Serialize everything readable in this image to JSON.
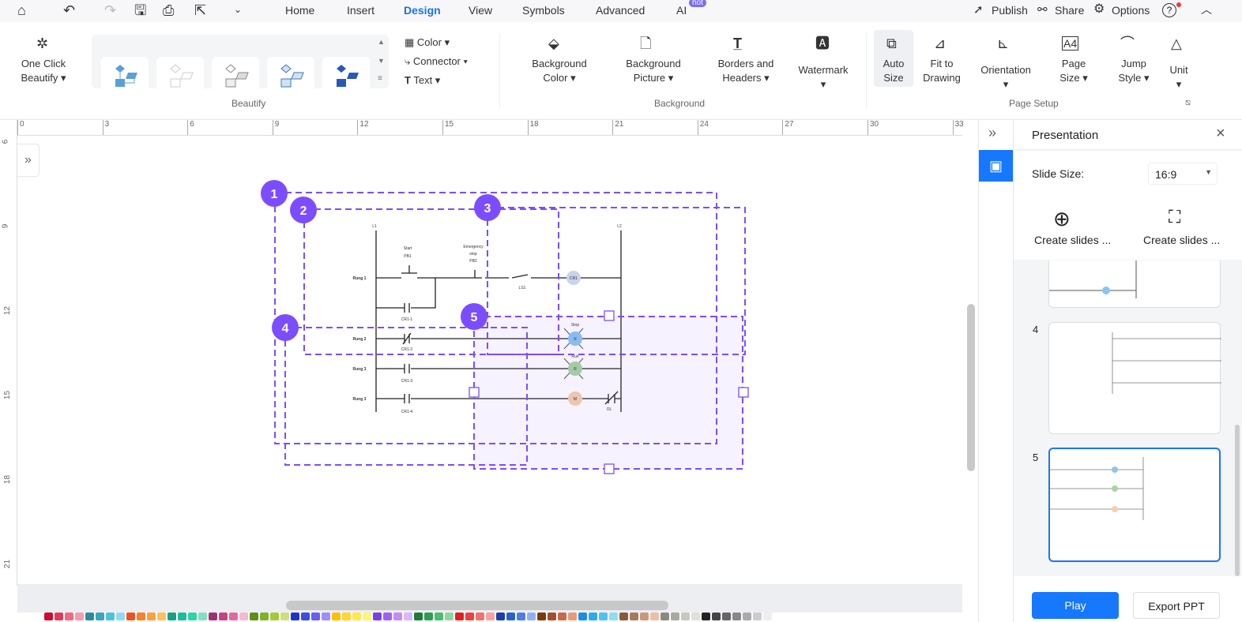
{
  "toolbar": {
    "icons": [
      "home-icon",
      "undo-icon",
      "redo-icon",
      "save-icon",
      "print-icon",
      "export-icon",
      "more-icon"
    ]
  },
  "tabs": [
    {
      "label": "Home"
    },
    {
      "label": "Insert"
    },
    {
      "label": "Design",
      "active": true
    },
    {
      "label": "View"
    },
    {
      "label": "Symbols"
    },
    {
      "label": "Advanced"
    },
    {
      "label": "AI",
      "badge": "hot"
    }
  ],
  "top_right": {
    "publish": "Publish",
    "share": "Share",
    "options": "Options",
    "help": "?"
  },
  "ribbon": {
    "beautify": {
      "one_click": "One Click",
      "beautify": "Beautify",
      "group": "Beautify",
      "color": "Color",
      "connector": "Connector",
      "text": "Text"
    },
    "background": {
      "bg_color_1": "Background",
      "bg_color_2": "Color",
      "bg_pic_1": "Background",
      "bg_pic_2": "Picture",
      "borders_1": "Borders and",
      "borders_2": "Headers",
      "watermark": "Watermark",
      "group": "Background"
    },
    "page_setup": {
      "auto_1": "Auto",
      "auto_2": "Size",
      "fit_1": "Fit to",
      "fit_2": "Drawing",
      "orientation": "Orientation",
      "page_1": "Page",
      "page_2": "Size",
      "jump_1": "Jump",
      "jump_2": "Style",
      "unit": "Unit",
      "group": "Page Setup"
    }
  },
  "ruler": {
    "h": [
      "0",
      "3",
      "6",
      "9",
      "12",
      "15",
      "18",
      "21",
      "24",
      "27",
      "30",
      "33"
    ],
    "v": [
      "6",
      "9",
      "12",
      "15",
      "18",
      "21"
    ]
  },
  "diagram": {
    "l1": "L1",
    "l2": "L2",
    "start": "Start",
    "pb1": "PB1",
    "estop_1": "Emergency",
    "estop_2": "stop",
    "pb2": "PB2",
    "ls1": "LS1",
    "cr1": "CR1",
    "rung1": "Rung 1",
    "rung2": "Rung 2",
    "rung3a": "Rung 3",
    "rung3b": "Rung 3",
    "cr1_1": "CR1-1",
    "cr1_2": "CR1-2",
    "cr1_3": "CR1-3",
    "cr1_4": "CR1-4",
    "stop": "Stop",
    "run": "Run",
    "r1": "R",
    "r2": "R",
    "m": "M",
    "ol": "OL"
  },
  "selections": [
    "1",
    "2",
    "3",
    "4",
    "5"
  ],
  "panel": {
    "title": "Presentation",
    "slide_size_label": "Slide Size:",
    "slide_size_value": "16:9",
    "create1": "Create slides ...",
    "create2": "Create slides ...",
    "slides": [
      {
        "num": "4"
      },
      {
        "num": "5",
        "selected": true
      }
    ],
    "play": "Play",
    "export": "Export PPT"
  },
  "colors": {
    "accent": "#1a73e8",
    "selection": "#7c4dff",
    "play": "#1677ff"
  },
  "palette": [
    "#c8102e",
    "#e03c5a",
    "#ef6b84",
    "#f59ab0",
    "#2e8b9a",
    "#3aa6b9",
    "#4cc3d9",
    "#8fdcef",
    "#f25022",
    "#f7802a",
    "#f9a03f",
    "#fbc060",
    "#16a085",
    "#1abc9c",
    "#2ed3a8",
    "#7fe0c2",
    "#a0306e",
    "#c2457f",
    "#e06aa0",
    "#f5b8d0",
    "#5a8f1b",
    "#7cb32a",
    "#a4c93a",
    "#cde07a",
    "#2233c8",
    "#3a4ee0",
    "#6a5cf5",
    "#9d8ff7",
    "#ffc000",
    "#ffd633",
    "#ffe74c",
    "#fff47a",
    "#7b3fe4",
    "#a25ff0",
    "#c58af5",
    "#ddb5fa",
    "#1e7b3a",
    "#2e9e52",
    "#4dbb70",
    "#8fd6a3",
    "#e02020",
    "#f04040",
    "#f57070",
    "#faa0a0",
    "#1a3fa8",
    "#2a5fd0",
    "#4a7fe8",
    "#8fb0f5",
    "#7a3a0a",
    "#a0502a",
    "#c86a4a",
    "#e89a7a",
    "#1a8fe0",
    "#30a8f0",
    "#50c0f5",
    "#8fdcfa",
    "#8a5a3a",
    "#a87a5a",
    "#c89a7a",
    "#e8c0a8",
    "#8a8a80",
    "#a8a8a0",
    "#c8c8c0",
    "#e0e0d8",
    "#222222",
    "#444444",
    "#666666",
    "#888888",
    "#aaaaaa",
    "#cccccc",
    "#eeeeee"
  ]
}
